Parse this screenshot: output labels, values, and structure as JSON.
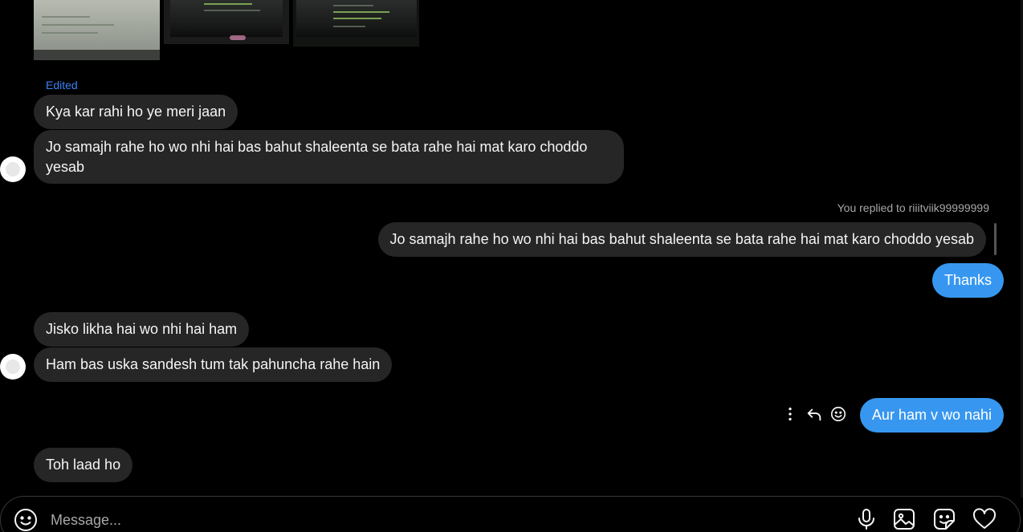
{
  "thread": {
    "edited_label": "Edited",
    "replied_label": "You replied to riiitviik99999999",
    "messages": [
      {
        "side": "received",
        "text": "Kya kar rahi ho ye meri jaan"
      },
      {
        "side": "received",
        "text": "Jo samajh rahe ho wo nhi hai bas bahut shaleenta se bata rahe hai mat karo choddo yesab"
      },
      {
        "side": "quoted",
        "text": "Jo samajh rahe ho wo nhi hai bas bahut shaleenta se bata rahe hai mat karo choddo yesab"
      },
      {
        "side": "sent",
        "text": "Thanks"
      },
      {
        "side": "received",
        "text": "Jisko likha hai wo nhi hai ham"
      },
      {
        "side": "received",
        "text": "Ham bas uska sandesh tum tak pahuncha rahe hain"
      },
      {
        "side": "sent",
        "text": "Aur ham v wo nahi"
      },
      {
        "side": "received",
        "text": "Toh laad ho"
      }
    ],
    "message_actions": [
      "more-icon",
      "reply-icon",
      "react-emoji-icon"
    ]
  },
  "composer": {
    "placeholder": "Message...",
    "icons": [
      "emoji-icon",
      "microphone-icon",
      "image-icon",
      "sticker-icon",
      "heart-icon"
    ]
  },
  "colors": {
    "background": "#000000",
    "received_bubble": "#262626",
    "sent_bubble": "#3797f0",
    "edited_label": "#3b82f6",
    "muted_text": "#a8a8a8"
  }
}
